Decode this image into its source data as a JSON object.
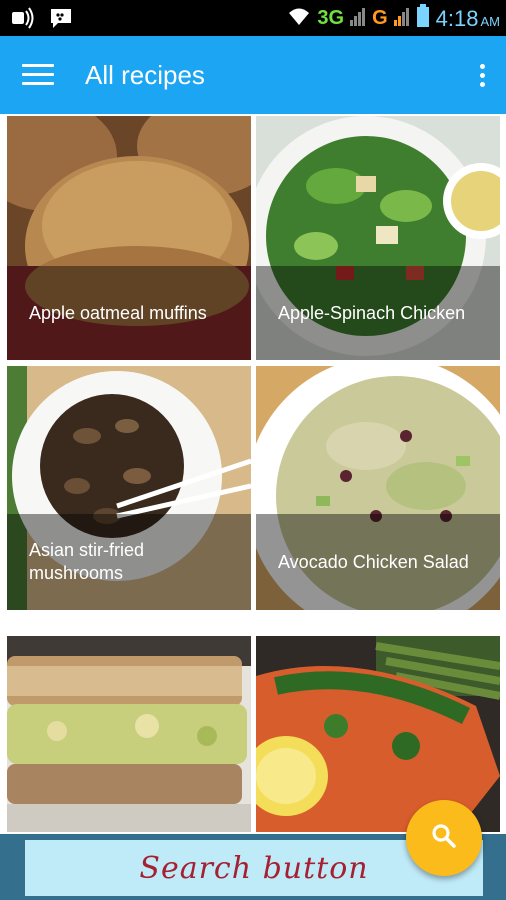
{
  "status_bar": {
    "network_3g": "3G",
    "network_g": "G",
    "time": "4:18",
    "ampm": "AM",
    "icons": [
      "signal-icon",
      "bbm-icon",
      "wifi-icon",
      "cell-signal-icon",
      "battery-icon"
    ]
  },
  "app_bar": {
    "title": "All recipes",
    "menu_icon": "menu-icon",
    "overflow_icon": "more-vert-icon",
    "color": "#1ba5f2"
  },
  "recipes": [
    {
      "title": "Apple oatmeal muffins"
    },
    {
      "title": "Apple-Spinach Chicken"
    },
    {
      "title": "Asian stir-fried mushrooms"
    },
    {
      "title": "Avocado Chicken Salad"
    },
    {
      "title": ""
    },
    {
      "title": ""
    }
  ],
  "fab": {
    "icon": "search-icon",
    "color": "#fbbb1b"
  },
  "banner": {
    "text": "Search button"
  }
}
